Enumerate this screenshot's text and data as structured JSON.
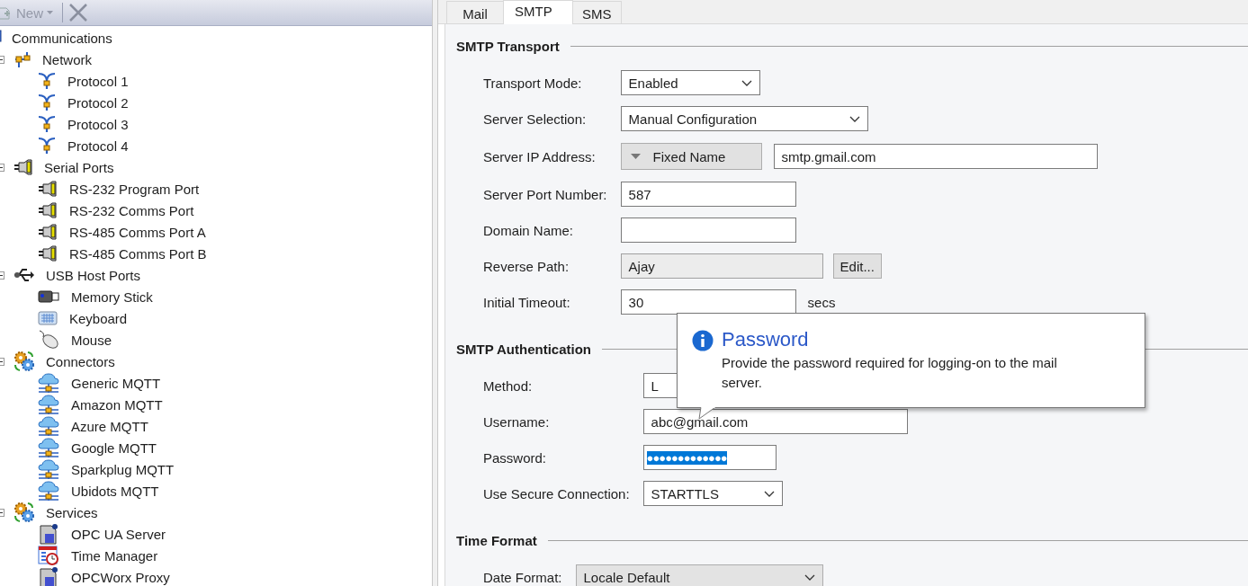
{
  "toolbar": {
    "new_button": {
      "label": "New",
      "disabled": true
    },
    "delete_button": {
      "disabled": true
    }
  },
  "tree": {
    "label": "Communications",
    "kind": "communications",
    "children": [
      {
        "label": "Network",
        "kind": "network",
        "expanded": true,
        "children": [
          {
            "label": "Protocol 1",
            "kind": "protocol"
          },
          {
            "label": "Protocol 2",
            "kind": "protocol"
          },
          {
            "label": "Protocol 3",
            "kind": "protocol"
          },
          {
            "label": "Protocol 4",
            "kind": "protocol"
          }
        ]
      },
      {
        "label": "Serial Ports",
        "kind": "serial",
        "expanded": true,
        "children": [
          {
            "label": "RS-232 Program Port",
            "kind": "port"
          },
          {
            "label": "RS-232 Comms Port",
            "kind": "port"
          },
          {
            "label": "RS-485 Comms Port A",
            "kind": "port"
          },
          {
            "label": "RS-485 Comms Port B",
            "kind": "port"
          }
        ]
      },
      {
        "label": "USB Host Ports",
        "kind": "usb",
        "expanded": true,
        "children": [
          {
            "label": "Memory Stick",
            "kind": "memory"
          },
          {
            "label": "Keyboard",
            "kind": "keyboard"
          },
          {
            "label": "Mouse",
            "kind": "mouse"
          }
        ]
      },
      {
        "label": "Connectors",
        "kind": "gears",
        "expanded": true,
        "children": [
          {
            "label": "Generic MQTT",
            "kind": "cloud"
          },
          {
            "label": "Amazon MQTT",
            "kind": "cloud"
          },
          {
            "label": "Azure MQTT",
            "kind": "cloud"
          },
          {
            "label": "Google MQTT",
            "kind": "cloud"
          },
          {
            "label": "Sparkplug MQTT",
            "kind": "cloud"
          },
          {
            "label": "Ubidots MQTT",
            "kind": "cloud"
          }
        ]
      },
      {
        "label": "Services",
        "kind": "gears",
        "expanded": true,
        "children": [
          {
            "label": "OPC UA Server",
            "kind": "server"
          },
          {
            "label": "Time Manager",
            "kind": "clock"
          },
          {
            "label": "OPCWorx Proxy",
            "kind": "server"
          }
        ]
      }
    ]
  },
  "tabs": [
    {
      "label": "Mail",
      "selected": false
    },
    {
      "label": "SMTP",
      "selected": true
    },
    {
      "label": "SMS",
      "selected": false
    }
  ],
  "sections": [
    {
      "title": "SMTP Transport",
      "fields": [
        {
          "label": "Transport Mode:",
          "kind": "select",
          "value": "Enabled"
        },
        {
          "label": "Server Selection:",
          "kind": "select",
          "value": "Manual Configuration"
        },
        {
          "label": "Server IP Address:",
          "kind": "mode-text",
          "mode": "Fixed Name",
          "value": "smtp.gmail.com"
        },
        {
          "label": "Server Port Number:",
          "kind": "text",
          "value": "587"
        },
        {
          "label": "Domain Name:",
          "kind": "text"
        },
        {
          "label": "Reverse Path:",
          "kind": "readonly-edit",
          "value": "Ajay",
          "button": "Edit..."
        },
        {
          "label": "Initial Timeout:",
          "kind": "text",
          "value": "30",
          "unit": "secs"
        }
      ]
    },
    {
      "title": "SMTP Authentication",
      "fields": [
        {
          "label": "Method:",
          "kind": "text",
          "value": "L"
        },
        {
          "label": "Username:",
          "kind": "text",
          "value": "abc@gmail.com"
        },
        {
          "label": "Password:",
          "kind": "password",
          "value": "●●●●●●●●●●●●●",
          "text_selected": true
        },
        {
          "label": "Use Secure Connection:",
          "kind": "select",
          "value": "STARTTLS"
        }
      ]
    },
    {
      "title": "Time Format",
      "fields": [
        {
          "label": "Date Format:",
          "kind": "select",
          "value": "Locale Default",
          "disabled": true
        }
      ]
    }
  ],
  "tooltip": {
    "title": "Password",
    "text": "Provide the password required for logging-on to the mail server."
  }
}
